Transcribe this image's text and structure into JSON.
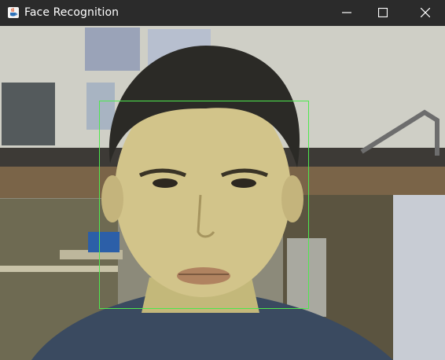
{
  "window": {
    "title": "Face Recognition",
    "app_icon": "java-coffee-cup-icon",
    "controls": {
      "minimize_icon": "minimize-icon",
      "maximize_icon": "maximize-icon",
      "close_icon": "close-icon"
    }
  },
  "camera_feed": {
    "content": "live webcam image of a person in a dorm room",
    "detection_box_color": "#4ee84e"
  }
}
